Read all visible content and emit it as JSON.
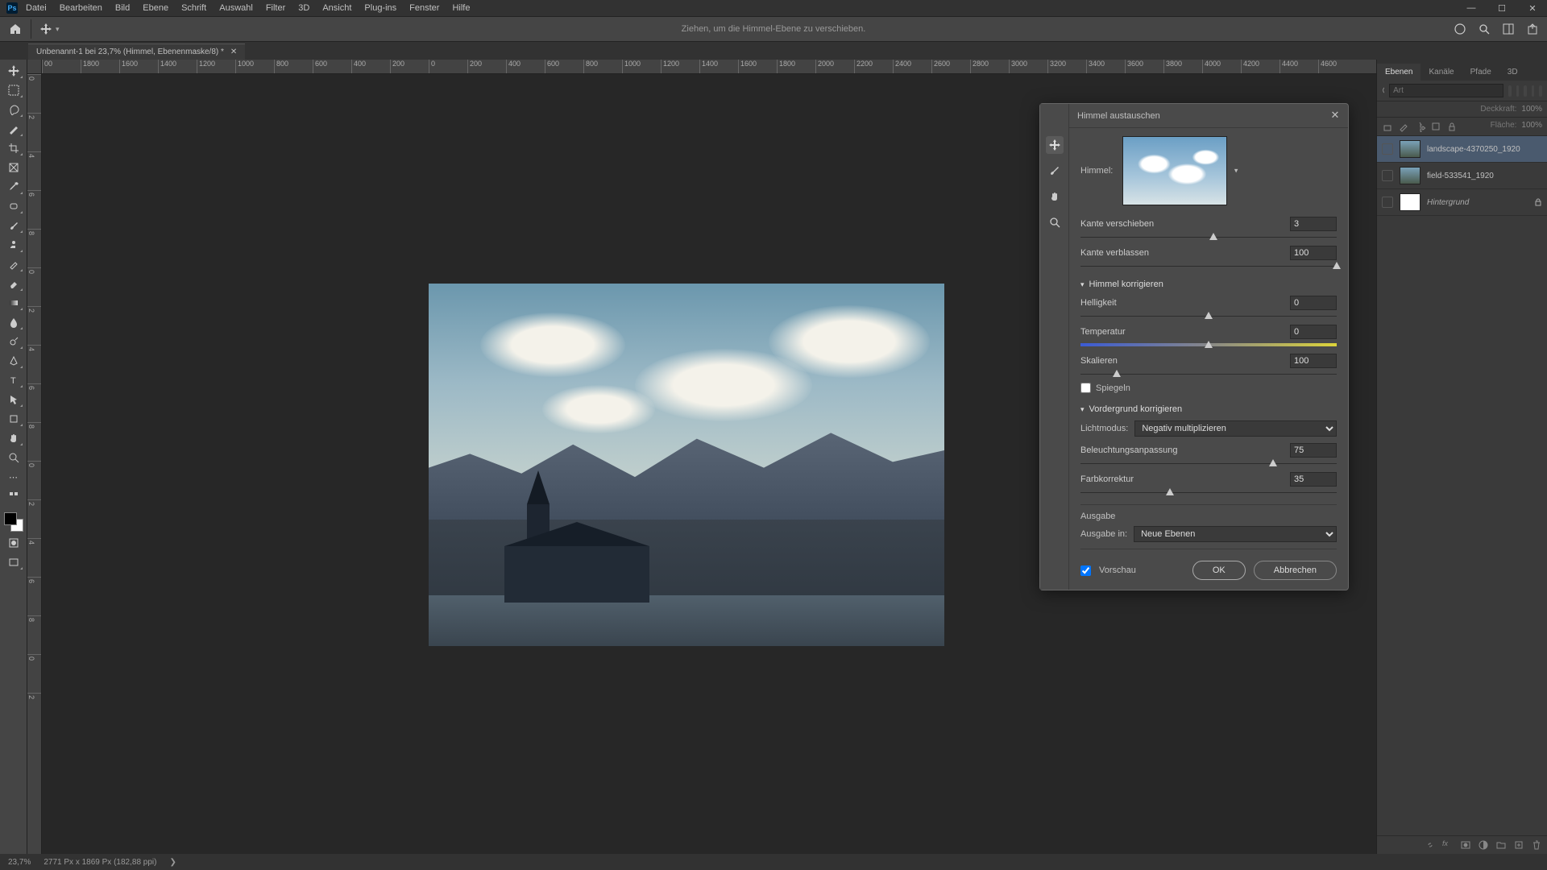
{
  "menu": [
    "Datei",
    "Bearbeiten",
    "Bild",
    "Ebene",
    "Schrift",
    "Auswahl",
    "Filter",
    "3D",
    "Ansicht",
    "Plug-ins",
    "Fenster",
    "Hilfe"
  ],
  "optbar_hint": "Ziehen, um die Himmel-Ebene zu verschieben.",
  "doc_tab": "Unbenannt-1 bei 23,7% (Himmel, Ebenenmaske/8) *",
  "ruler_h": [
    "00",
    "1800",
    "1600",
    "1400",
    "1200",
    "1000",
    "800",
    "600",
    "400",
    "200",
    "0",
    "200",
    "400",
    "600",
    "800",
    "1000",
    "1200",
    "1400",
    "1600",
    "1800",
    "2000",
    "2200",
    "2400",
    "2600",
    "2800",
    "3000",
    "3200",
    "3400",
    "3600",
    "3800",
    "4000",
    "4200",
    "4400",
    "4600"
  ],
  "ruler_v": [
    "0",
    "2",
    "4",
    "6",
    "8",
    "0",
    "2",
    "4",
    "6",
    "8",
    "0",
    "2",
    "4",
    "6",
    "8",
    "0",
    "2"
  ],
  "panels": {
    "tabs": [
      "Ebenen",
      "Kanäle",
      "Pfade",
      "3D"
    ],
    "filter_placeholder": "Art",
    "opacity_label": "Deckkraft:",
    "opacity_value": "100%",
    "fill_label": "Fläche:",
    "fill_value": "100%"
  },
  "layers": [
    {
      "name": "landscape-4370250_1920",
      "sel": true
    },
    {
      "name": "field-533541_1920",
      "sel": false
    },
    {
      "name": "Hintergrund",
      "sel": false,
      "locked": true,
      "italic": true,
      "white": true
    }
  ],
  "status": {
    "zoom": "23,7%",
    "docinfo": "2771 Px x 1869 Px (182,88 ppi)"
  },
  "dialog": {
    "title": "Himmel austauschen",
    "sky_label": "Himmel:",
    "shift_edge": {
      "label": "Kante verschieben",
      "value": "3",
      "pos": 52
    },
    "fade_edge": {
      "label": "Kante verblassen",
      "value": "100",
      "pos": 100
    },
    "sky_adj_header": "Himmel korrigieren",
    "brightness": {
      "label": "Helligkeit",
      "value": "0",
      "pos": 50
    },
    "temperature": {
      "label": "Temperatur",
      "value": "0",
      "pos": 50
    },
    "scale": {
      "label": "Skalieren",
      "value": "100",
      "pos": 14
    },
    "flip_label": "Spiegeln",
    "fg_adj_header": "Vordergrund korrigieren",
    "lighting_mode_label": "Lichtmodus:",
    "lighting_mode_value": "Negativ multiplizieren",
    "lighting_adj": {
      "label": "Beleuchtungsanpassung",
      "value": "75",
      "pos": 75
    },
    "color_adj": {
      "label": "Farbkorrektur",
      "value": "35",
      "pos": 35
    },
    "output_header": "Ausgabe",
    "output_to_label": "Ausgabe in:",
    "output_to_value": "Neue Ebenen",
    "preview_label": "Vorschau",
    "ok": "OK",
    "cancel": "Abbrechen"
  }
}
